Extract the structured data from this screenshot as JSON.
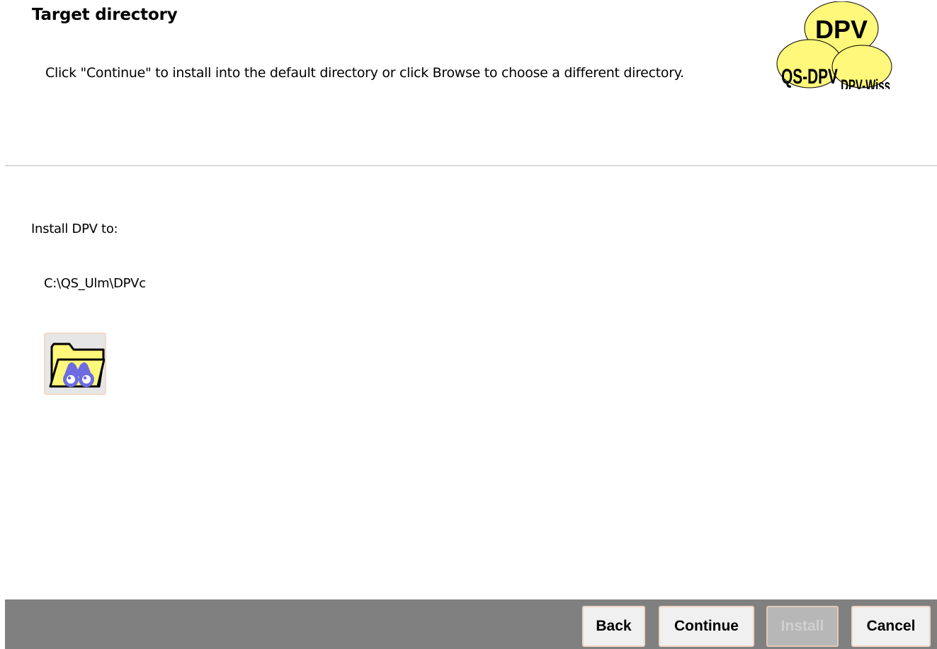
{
  "header": {
    "title": "Target directory",
    "subtitle": "Click \"Continue\" to install into the default directory or click Browse to choose a different directory."
  },
  "logo": {
    "top_label": "DPV",
    "left_label": "QS-DPV",
    "right_label": "DPV-Wiss",
    "fill_color": "#fff87a"
  },
  "main": {
    "install_label": "Install DPV to:",
    "install_path": "C:\\QS_Ulm\\DPVc",
    "browse_icon": "folder-binoculars-icon"
  },
  "footer": {
    "back_label": "Back",
    "continue_label": "Continue",
    "install_label": "Install",
    "cancel_label": "Cancel",
    "install_enabled": false
  }
}
